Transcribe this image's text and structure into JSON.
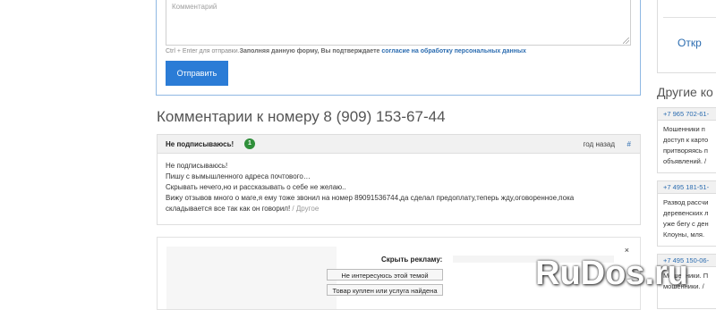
{
  "form": {
    "placeholder": "Комментарий",
    "hint_shortcut": "Ctrl + Enter для отправки.",
    "hint_consent": "Заполняя данную форму, Вы подтверждаете",
    "hint_link": "согласие на обработку персональных данных",
    "submit_label": "Отправить"
  },
  "section_title": "Комментарии к номеру 8 (909) 153-67-44",
  "comment": {
    "author": "Не подписываюсь!",
    "rating": "1",
    "time": "год назад",
    "anchor": "#",
    "lines": [
      "Не подписываюсь!",
      "Пишу с вымышленного адреса почтового…",
      "Скрывать нечего,но и рассказывать о себе не желаю..",
      "Вижу отзывов много о маге,я ему тоже звонил на номер 89091536744,да сделал предоплату,теперь жду,оговоренное,пока",
      "складывается все так как он говорил!"
    ],
    "other_link": "/ Другое"
  },
  "ad": {
    "close": "×",
    "title": "Скрыть рекламу:",
    "options": [
      "Не интересуюсь этой темой",
      "Товар куплен или услуга найдена"
    ]
  },
  "right_column": {
    "open_label": "Откр",
    "heading": "Другие ко",
    "cards": [
      {
        "phone": "+7 965 702-61-",
        "lines": [
          "Мошенники п",
          "доступ к карто",
          "притворяясь п",
          "объявлений. /"
        ]
      },
      {
        "phone": "+7 495 181-51-",
        "lines": [
          "Развод рассчи",
          "деревенских л",
          "уже бегу с ден",
          "Клоуны, мля."
        ]
      },
      {
        "phone": "+7 495 150-06-",
        "lines": [
          "Мошенники. П",
          "мошенники. /"
        ]
      }
    ]
  },
  "watermark": "RuDos.ru"
}
